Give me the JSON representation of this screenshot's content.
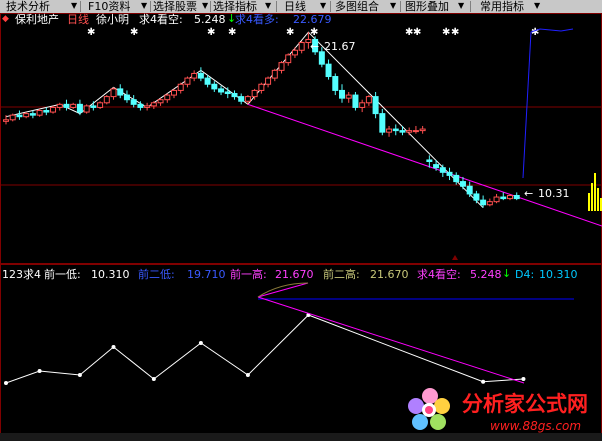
{
  "toolbar": {
    "buttons": [
      {
        "label": "技术分析"
      },
      {
        "label": "F10资料"
      },
      {
        "label": "选择股票"
      },
      {
        "label": "选择指标"
      },
      {
        "label": "日线"
      },
      {
        "label": "多图组合"
      },
      {
        "label": "图形叠加"
      },
      {
        "label": "常用指标"
      }
    ]
  },
  "header": {
    "stock_name": "保利地产",
    "period": "日线",
    "indicator_name": "徐小明",
    "bear_label": "求4看空:",
    "bear_value": "5.248",
    "bull_label": "求4看多:",
    "bull_value": "22.679"
  },
  "price_chart": {
    "high_label": "21.67",
    "low_label": "10.31"
  },
  "lower_panel": {
    "name": "123求4",
    "low1_label": "前一低:",
    "low1_value": "10.310",
    "low2_label": "前二低:",
    "low2_value": "19.710",
    "high1_label": "前一高:",
    "high1_value": "21.670",
    "high2_label": "前二高:",
    "high2_value": "21.670",
    "bear_label": "求4看空:",
    "bear_value": "5.248",
    "d4_label": "D4:",
    "d4_value": "10.310"
  },
  "watermark": {
    "title": "分析家公式网",
    "url": "www.88gs.com"
  },
  "colors": {
    "up": "#ff5050",
    "down": "#54ffff",
    "zigzag": "#ffffff",
    "support": "#ff00ff",
    "blue_line": "#0000ff",
    "grid": "#800000",
    "yellow": "#ffff00",
    "bull_text": "#3a5aff"
  },
  "chart_data": {
    "type": "candlestick",
    "candles": [
      [
        0,
        15.9,
        16.3,
        16.0,
        15.7
      ],
      [
        1,
        16.0,
        16.4,
        16.3,
        15.9
      ],
      [
        2,
        16.3,
        16.6,
        16.2,
        16.0
      ],
      [
        3,
        16.2,
        16.5,
        16.4,
        16.1
      ],
      [
        4,
        16.4,
        16.6,
        16.3,
        16.1
      ],
      [
        5,
        16.3,
        16.7,
        16.6,
        16.2
      ],
      [
        6,
        16.6,
        16.8,
        16.5,
        16.3
      ],
      [
        7,
        16.5,
        16.9,
        16.8,
        16.4
      ],
      [
        8,
        16.8,
        17.1,
        17.0,
        16.6
      ],
      [
        9,
        17.0,
        17.3,
        16.8,
        16.6
      ],
      [
        10,
        16.8,
        17.1,
        17.0,
        16.7
      ],
      [
        11,
        17.0,
        17.3,
        16.5,
        16.3
      ],
      [
        12,
        16.5,
        17.0,
        16.9,
        16.4
      ],
      [
        13,
        16.9,
        17.2,
        16.8,
        16.6
      ],
      [
        14,
        16.8,
        17.2,
        17.1,
        16.7
      ],
      [
        15,
        17.1,
        17.6,
        17.5,
        17.0
      ],
      [
        16,
        17.5,
        18.1,
        18.0,
        17.3
      ],
      [
        17,
        18.0,
        18.3,
        17.6,
        17.4
      ],
      [
        18,
        17.6,
        17.9,
        17.3,
        17.1
      ],
      [
        19,
        17.3,
        17.6,
        17.0,
        16.8
      ],
      [
        20,
        17.0,
        17.2,
        16.8,
        16.6
      ],
      [
        21,
        16.8,
        17.1,
        16.9,
        16.6
      ],
      [
        22,
        16.9,
        17.2,
        17.1,
        16.7
      ],
      [
        23,
        17.1,
        17.4,
        17.3,
        16.9
      ],
      [
        24,
        17.3,
        17.7,
        17.6,
        17.1
      ],
      [
        25,
        17.6,
        18.0,
        17.9,
        17.4
      ],
      [
        26,
        17.9,
        18.4,
        18.3,
        17.7
      ],
      [
        27,
        18.3,
        18.8,
        18.7,
        18.1
      ],
      [
        28,
        18.7,
        19.2,
        19.0,
        18.5
      ],
      [
        29,
        19.0,
        19.4,
        18.7,
        18.5
      ],
      [
        30,
        18.7,
        18.9,
        18.3,
        18.1
      ],
      [
        31,
        18.3,
        18.5,
        18.0,
        17.8
      ],
      [
        32,
        18.0,
        18.2,
        17.8,
        17.6
      ],
      [
        33,
        17.8,
        18.1,
        17.7,
        17.4
      ],
      [
        34,
        17.7,
        17.9,
        17.5,
        17.3
      ],
      [
        35,
        17.5,
        17.7,
        17.2,
        17.0
      ],
      [
        36,
        17.2,
        17.6,
        17.5,
        17.0
      ],
      [
        37,
        17.5,
        18.0,
        17.9,
        17.3
      ],
      [
        38,
        17.9,
        18.4,
        18.3,
        17.7
      ],
      [
        39,
        18.3,
        18.8,
        18.7,
        18.1
      ],
      [
        40,
        18.7,
        19.3,
        19.2,
        18.5
      ],
      [
        41,
        19.2,
        19.8,
        19.7,
        19.0
      ],
      [
        42,
        19.7,
        20.3,
        20.2,
        19.5
      ],
      [
        43,
        20.2,
        20.7,
        20.5,
        20.0
      ],
      [
        44,
        20.5,
        21.1,
        21.0,
        20.3
      ],
      [
        45,
        21.0,
        21.67,
        21.2,
        20.6
      ],
      [
        46,
        21.2,
        21.4,
        20.4,
        20.2
      ],
      [
        47,
        20.4,
        20.7,
        19.6,
        19.4
      ],
      [
        48,
        19.6,
        19.9,
        18.8,
        18.6
      ],
      [
        49,
        18.8,
        19.0,
        17.9,
        17.6
      ],
      [
        50,
        17.9,
        18.3,
        17.4,
        17.1
      ],
      [
        51,
        17.4,
        17.8,
        17.6,
        17.1
      ],
      [
        52,
        17.6,
        17.8,
        16.8,
        16.6
      ],
      [
        53,
        16.8,
        17.3,
        17.1,
        16.5
      ],
      [
        54,
        17.1,
        17.6,
        17.5,
        16.9
      ],
      [
        55,
        17.5,
        17.8,
        16.4,
        16.1
      ],
      [
        56,
        16.4,
        16.7,
        15.2,
        15.0
      ],
      [
        57,
        15.2,
        15.6,
        15.4,
        14.9
      ],
      [
        58,
        15.4,
        15.7,
        15.3,
        15.0
      ],
      [
        59,
        15.3,
        15.6,
        15.2,
        15.0
      ],
      [
        60,
        15.2,
        15.5,
        15.3,
        15.0
      ],
      [
        61,
        15.3,
        15.6,
        15.3,
        15.1
      ],
      [
        62,
        15.3,
        15.6,
        15.4,
        15.1
      ],
      [
        63,
        13.4,
        13.7,
        13.3,
        12.9
      ],
      [
        64,
        13.1,
        13.4,
        12.9,
        12.7
      ],
      [
        65,
        12.9,
        13.1,
        12.6,
        12.3
      ],
      [
        66,
        12.6,
        12.9,
        12.4,
        12.1
      ],
      [
        67,
        12.4,
        12.6,
        12.0,
        11.8
      ],
      [
        68,
        12.0,
        12.3,
        11.7,
        11.5
      ],
      [
        69,
        11.7,
        12.0,
        11.2,
        11.0
      ],
      [
        70,
        11.2,
        11.4,
        10.8,
        10.6
      ],
      [
        71,
        10.8,
        11.1,
        10.5,
        10.31
      ],
      [
        72,
        10.5,
        10.9,
        10.7,
        10.4
      ],
      [
        73,
        10.7,
        11.2,
        11.0,
        10.6
      ],
      [
        74,
        11.0,
        11.3,
        10.9,
        10.8
      ],
      [
        75,
        10.9,
        11.2,
        11.1,
        10.8
      ],
      [
        76,
        11.1,
        11.3,
        10.9,
        10.8
      ]
    ],
    "zigzag": [
      [
        0,
        16.2
      ],
      [
        4,
        16.6
      ],
      [
        8,
        17.0
      ],
      [
        11,
        16.4
      ],
      [
        16,
        18.1
      ],
      [
        21,
        16.8
      ],
      [
        29,
        19.2
      ],
      [
        36,
        17.0
      ],
      [
        45,
        21.67
      ],
      [
        71,
        10.31
      ]
    ],
    "support_line": [
      [
        36,
        17.0
      ],
      [
        77,
        9.3
      ]
    ],
    "lower_series": [
      {
        "name": "前一低",
        "values": [
          [
            0,
            10
          ],
          [
            5,
            13
          ],
          [
            11,
            12
          ],
          [
            16,
            19
          ],
          [
            22,
            11
          ],
          [
            29,
            20
          ],
          [
            36,
            12
          ],
          [
            45,
            27
          ],
          [
            71,
            10.31
          ],
          [
            77,
            11
          ]
        ]
      }
    ]
  }
}
